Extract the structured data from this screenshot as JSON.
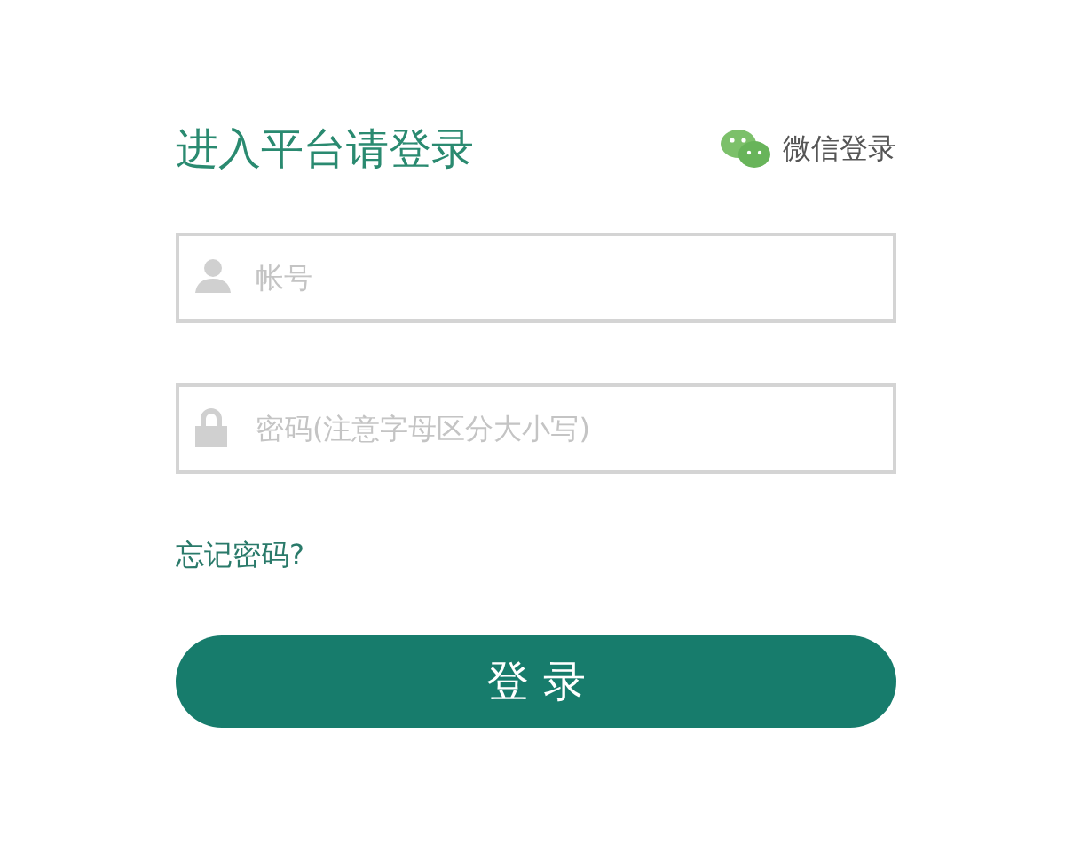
{
  "header": {
    "title": "进入平台请登录",
    "wechat_login": "微信登录"
  },
  "fields": [
    {
      "kind": "user",
      "placeholder": "帐号"
    },
    {
      "kind": "lock",
      "placeholder": "密码(注意字母区分大小写)"
    }
  ],
  "forgot_link": "忘记密码?",
  "submit_button": "登 录"
}
